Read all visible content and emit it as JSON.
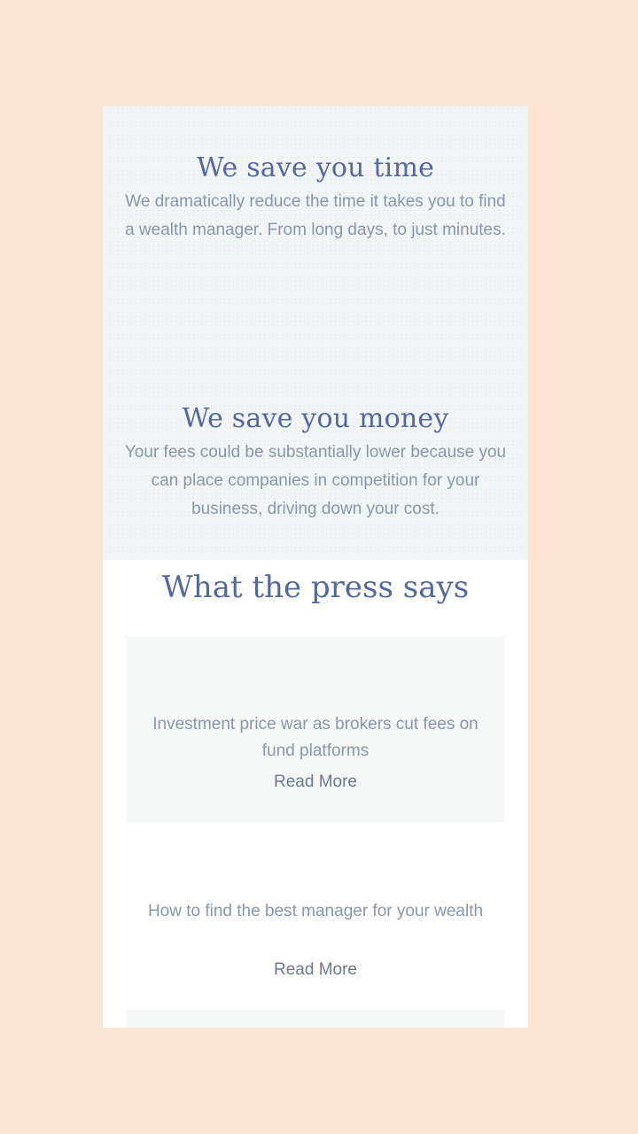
{
  "benefits": [
    {
      "title": "We save you time",
      "text": "We dramatically reduce the time it takes you to find a wealth manager. From long days, to just minutes."
    },
    {
      "title": "We save you money",
      "text": "Your fees could be substantially lower because you can place companies in competition for your business, driving down your cost."
    }
  ],
  "press": {
    "title": "What the press says",
    "articles": [
      {
        "headline": "Investment price war as brokers cut fees on fund platforms",
        "link_label": "Read More"
      },
      {
        "headline": "How to find the best manager for your wealth",
        "link_label": "Read More"
      }
    ]
  },
  "colors": {
    "page_background": "#fde3d3",
    "heading": "#5468a0",
    "body_text": "#8896ab",
    "link": "#6c7891",
    "section_background": "#f2f5f5"
  }
}
